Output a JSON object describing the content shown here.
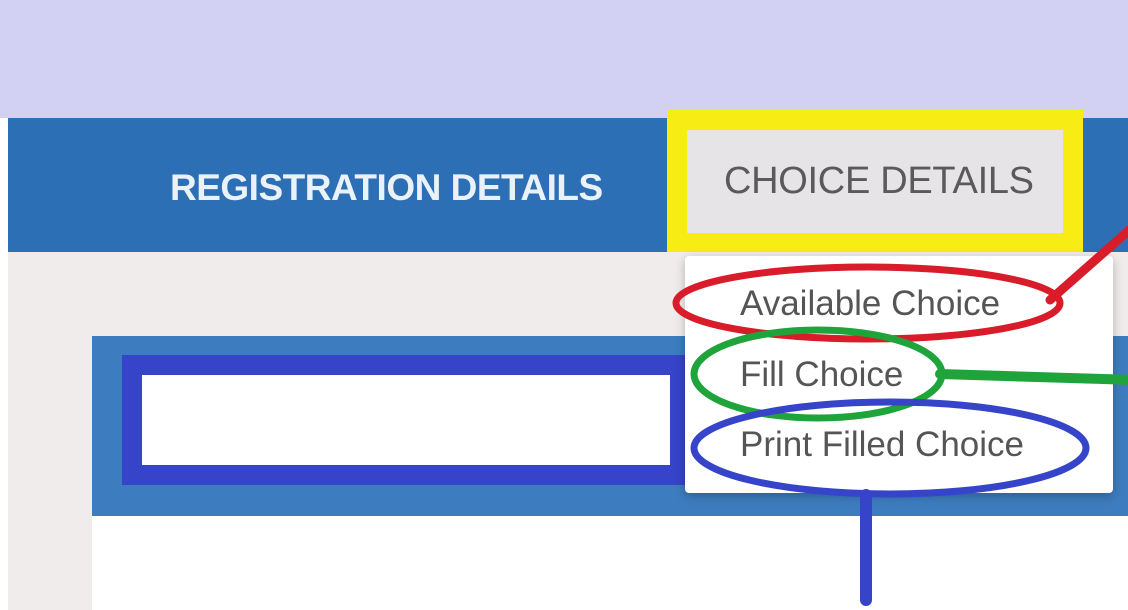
{
  "navbar": {
    "registration_label": "REGISTRATION DETAILS",
    "choice_label": "CHOICE DETAILS"
  },
  "choice_menu": {
    "items": [
      {
        "label": "Available Choice",
        "annotation_color": "#d91c2a"
      },
      {
        "label": "Fill Choice",
        "annotation_color": "#1fa43c"
      },
      {
        "label": "Print Filled Choice",
        "annotation_color": "#3544c8"
      }
    ]
  },
  "search": {
    "value": "",
    "placeholder": ""
  },
  "colors": {
    "top_band": "#d3d1f3",
    "navbar": "#2d6fb4",
    "highlight": "#f7ed14",
    "panel_header": "#3d7cbf",
    "page_background": "#efeceb"
  }
}
